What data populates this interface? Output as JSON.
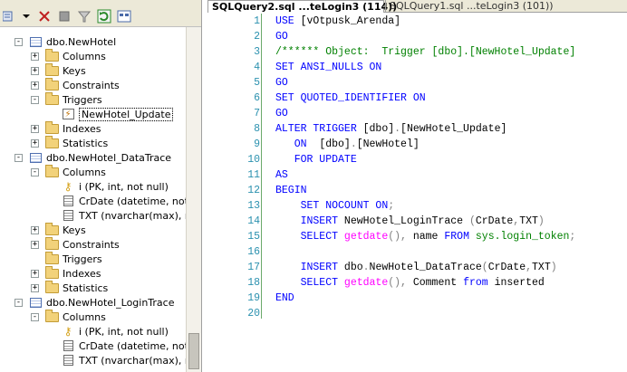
{
  "explorer": {
    "tree": [
      {
        "label": "dbo.NewHotel",
        "type": "table",
        "expander": "−"
      },
      {
        "label": "Columns",
        "type": "folder",
        "expander": "+"
      },
      {
        "label": "Keys",
        "type": "folder",
        "expander": "+"
      },
      {
        "label": "Constraints",
        "type": "folder",
        "expander": "+"
      },
      {
        "label": "Triggers",
        "type": "folder",
        "expander": "−"
      },
      {
        "label": "NewHotel_Update",
        "type": "trigger",
        "expander": ""
      },
      {
        "label": "Indexes",
        "type": "folder",
        "expander": "+"
      },
      {
        "label": "Statistics",
        "type": "folder",
        "expander": "+"
      },
      {
        "label": "dbo.NewHotel_DataTrace",
        "type": "table",
        "expander": "−"
      },
      {
        "label": "Columns",
        "type": "folder",
        "expander": "−"
      },
      {
        "label": "i (PK, int, not null)",
        "type": "key",
        "expander": ""
      },
      {
        "label": "CrDate (datetime, not nu",
        "type": "column",
        "expander": ""
      },
      {
        "label": "TXT (nvarchar(max), nu",
        "type": "column",
        "expander": ""
      },
      {
        "label": "Keys",
        "type": "folder",
        "expander": "+"
      },
      {
        "label": "Constraints",
        "type": "folder",
        "expander": "+"
      },
      {
        "label": "Triggers",
        "type": "folder",
        "expander": ""
      },
      {
        "label": "Indexes",
        "type": "folder",
        "expander": "+"
      },
      {
        "label": "Statistics",
        "type": "folder",
        "expander": "+"
      },
      {
        "label": "dbo.NewHotel_LoginTrace",
        "type": "table",
        "expander": "−"
      },
      {
        "label": "Columns",
        "type": "folder",
        "expander": "−"
      },
      {
        "label": "i (PK, int, not null)",
        "type": "key",
        "expander": ""
      },
      {
        "label": "CrDate (datetime, not n",
        "type": "column",
        "expander": ""
      },
      {
        "label": "TXT (nvarchar(max), nu",
        "type": "column",
        "expander": ""
      }
    ]
  },
  "tabs": {
    "active": "SQLQuery2.sql ...teLogin3 (114))",
    "inactive": "SQLQuery1.sql ...teLogin3 (101))"
  },
  "editor": {
    "line_numbers": [
      "1",
      "2",
      "3",
      "4",
      "5",
      "6",
      "7",
      "8",
      "9",
      "10",
      "11",
      "12",
      "13",
      "14",
      "15",
      "16",
      "17",
      "18",
      "19",
      "20"
    ],
    "lines": [
      [
        {
          "t": "USE ",
          "c": "kw"
        },
        {
          "t": "[vOtpusk_Arenda]",
          "c": "tx"
        }
      ],
      [
        {
          "t": "GO",
          "c": "kw"
        }
      ],
      [
        {
          "t": "/****** Object:  Trigger [dbo].[NewHotel_Update]",
          "c": "cm"
        }
      ],
      [
        {
          "t": "SET ANSI_NULLS ON",
          "c": "kw"
        }
      ],
      [
        {
          "t": "GO",
          "c": "kw"
        }
      ],
      [
        {
          "t": "SET QUOTED_IDENTIFIER ON",
          "c": "kw"
        }
      ],
      [
        {
          "t": "GO",
          "c": "kw"
        }
      ],
      [
        {
          "t": "ALTER TRIGGER ",
          "c": "kw"
        },
        {
          "t": "[dbo]",
          "c": "tx"
        },
        {
          "t": ".",
          "c": "op"
        },
        {
          "t": "[NewHotel_Update]",
          "c": "tx"
        }
      ],
      [
        {
          "t": "   ON  ",
          "c": "kw"
        },
        {
          "t": "[dbo]",
          "c": "tx"
        },
        {
          "t": ".",
          "c": "op"
        },
        {
          "t": "[NewHotel]",
          "c": "tx"
        }
      ],
      [
        {
          "t": "   FOR UPDATE",
          "c": "kw"
        }
      ],
      [
        {
          "t": "AS",
          "c": "kw"
        }
      ],
      [
        {
          "t": "BEGIN",
          "c": "kw"
        }
      ],
      [
        {
          "t": "    SET NOCOUNT ON",
          "c": "kw"
        },
        {
          "t": ";",
          "c": "op"
        }
      ],
      [
        {
          "t": "    INSERT ",
          "c": "kw"
        },
        {
          "t": "NewHotel_LoginTrace ",
          "c": "tx"
        },
        {
          "t": "(",
          "c": "op"
        },
        {
          "t": "CrDate",
          "c": "tx"
        },
        {
          "t": ",",
          "c": "op"
        },
        {
          "t": "TXT",
          "c": "tx"
        },
        {
          "t": ")",
          "c": "op"
        }
      ],
      [
        {
          "t": "    SELECT ",
          "c": "kw"
        },
        {
          "t": "getdate",
          "c": "fn"
        },
        {
          "t": "(),",
          "c": "op"
        },
        {
          "t": " name ",
          "c": "tx"
        },
        {
          "t": "FROM ",
          "c": "kw"
        },
        {
          "t": "sys.login_token",
          "c": "sy"
        },
        {
          "t": ";",
          "c": "op"
        }
      ],
      [],
      [
        {
          "t": "    INSERT ",
          "c": "kw"
        },
        {
          "t": "dbo",
          "c": "tx"
        },
        {
          "t": ".",
          "c": "op"
        },
        {
          "t": "NewHotel_DataTrace",
          "c": "tx"
        },
        {
          "t": "(",
          "c": "op"
        },
        {
          "t": "CrDate",
          "c": "tx"
        },
        {
          "t": ",",
          "c": "op"
        },
        {
          "t": "TXT",
          "c": "tx"
        },
        {
          "t": ")",
          "c": "op"
        }
      ],
      [
        {
          "t": "    SELECT ",
          "c": "kw"
        },
        {
          "t": "getdate",
          "c": "fn"
        },
        {
          "t": "(),",
          "c": "op"
        },
        {
          "t": " Comment ",
          "c": "tx"
        },
        {
          "t": "from ",
          "c": "kw"
        },
        {
          "t": "inserted",
          "c": "tx"
        }
      ],
      [
        {
          "t": "END",
          "c": "kw"
        }
      ],
      []
    ]
  }
}
